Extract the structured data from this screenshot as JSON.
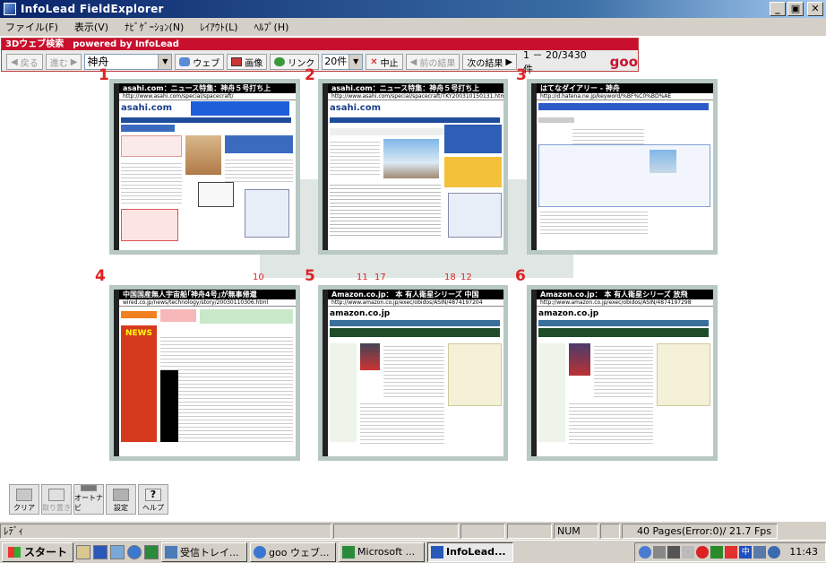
{
  "window": {
    "title": "InfoLead FieldExplorer"
  },
  "menu": [
    "ファイル(F)",
    "表示(V)",
    "ﾅﾋﾞｹﾞｰｼｮﾝ(N)",
    "ﾚｲｱｳﾄ(L)",
    "ﾍﾙﾌﾟ(H)"
  ],
  "searchbar": {
    "header": "3Dウェブ検索　powered by InfoLead",
    "back": "戻る",
    "forward": "進む",
    "query": "神舟",
    "web_button": "ウェブ",
    "image_button": "画像",
    "link_button": "リンク",
    "count_select": "20件",
    "stop_button": "中止",
    "prev_button": "前の結果",
    "next_button": "次の結果",
    "results": "1 － 20/3430件",
    "logo": "goo"
  },
  "result_labels": {
    "big": [
      "1",
      "2",
      "3",
      "4",
      "5",
      "6"
    ],
    "small": [
      "10",
      "11",
      "17",
      "18",
      "12"
    ]
  },
  "pages": [
    {
      "title": "asahi.com：ニュース特集：神舟５号打ち上",
      "url": "http://www.asahi.com/special/spacecraft/"
    },
    {
      "title": "asahi.com：ニュース特集：神舟５号打ち上",
      "url": "http://www.asahi.com/special/spacecraft/TKY200310150131.html"
    },
    {
      "title": "はてなダイアリー - 神舟",
      "url": "http://d.hatena.ne.jp/keyword/%BF%C0%BD%AE"
    },
    {
      "title": "中国国産無人宇宙船｢神舟4号｣が無事帰還",
      "url": "wired.co.jp/news/technology/story/20030110306.html"
    },
    {
      "title": "Amazon.co.jp： 本 有人衛星シリーズ 中国",
      "url": "http://www.amazon.co.jp/exec/obidos/ASIN/4874197204"
    },
    {
      "title": "Amazon.co.jp： 本 有人衛星シリーズ 放飛",
      "url": "http://www.amazon.co.jp/exec/obidos/ASIN/4874197298"
    }
  ],
  "bottom_buttons": [
    "クリア",
    "取り置き",
    "オートナビ",
    "設定",
    "ヘルプ"
  ],
  "status": {
    "ready": "ﾚﾃﾞｨ",
    "num": "NUM",
    "pages": "40 Pages(Error:0)/ 21.7 Fps"
  },
  "taskbar": {
    "start": "スタート",
    "tasks": [
      "受信トレイ...",
      "goo ウェブ...",
      "Microsoft ...",
      "InfoLead..."
    ],
    "clock": "11:43"
  }
}
